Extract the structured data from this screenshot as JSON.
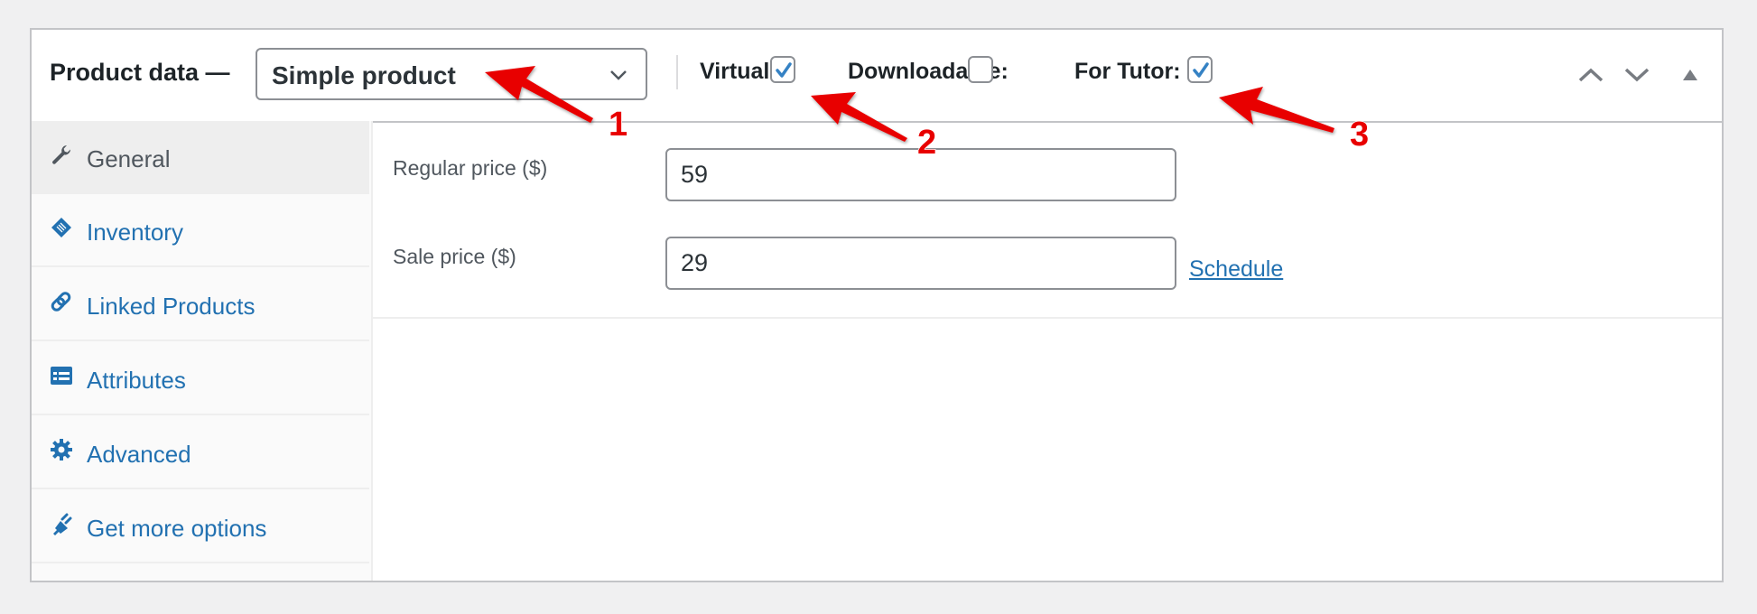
{
  "header": {
    "title": "Product data —",
    "product_type": {
      "selected": "Simple product"
    },
    "options": [
      {
        "label": "Virtual:",
        "checked": true
      },
      {
        "label": "Downloadable:",
        "checked": false
      },
      {
        "label": "For Tutor:",
        "checked": true
      }
    ],
    "controls": [
      "move-up",
      "move-down",
      "toggle-panel"
    ]
  },
  "sidebar": {
    "items": [
      {
        "label": "General",
        "icon": "wrench-icon",
        "active": true
      },
      {
        "label": "Inventory",
        "icon": "clipboard-tag-icon",
        "active": false
      },
      {
        "label": "Linked Products",
        "icon": "link-icon",
        "active": false
      },
      {
        "label": "Attributes",
        "icon": "list-table-icon",
        "active": false
      },
      {
        "label": "Advanced",
        "icon": "gear-icon",
        "active": false
      },
      {
        "label": "Get more options",
        "icon": "plug-icon",
        "active": false
      }
    ]
  },
  "general": {
    "regular_price": {
      "label": "Regular price ($)",
      "value": "59"
    },
    "sale_price": {
      "label": "Sale price ($)",
      "value": "29"
    },
    "schedule_link": "Schedule"
  },
  "annotations": [
    {
      "number": "1",
      "target": "product-type-select"
    },
    {
      "number": "2",
      "target": "virtual-checkbox"
    },
    {
      "number": "3",
      "target": "for-tutor-checkbox"
    }
  ],
  "colors": {
    "link": "#2271b1",
    "annotation": "#ee0000",
    "border": "#c3c4c7",
    "checkmark": "#3582c4"
  }
}
